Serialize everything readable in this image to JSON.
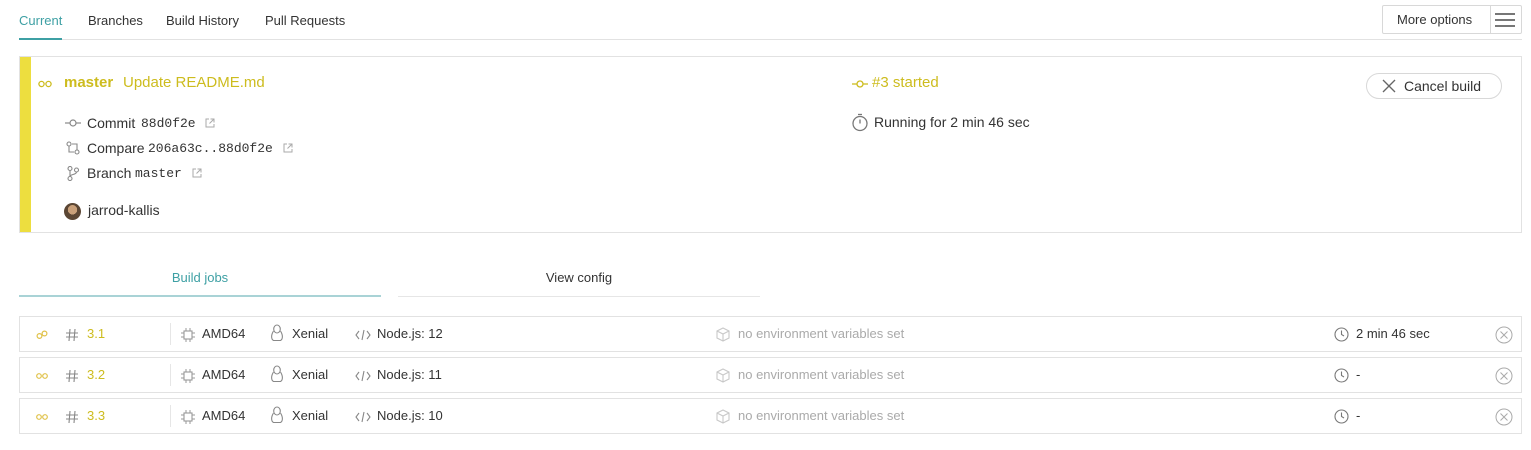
{
  "top_tabs": [
    {
      "label": "Current"
    },
    {
      "label": "Branches"
    },
    {
      "label": "Build History"
    },
    {
      "label": "Pull Requests"
    }
  ],
  "more_options": "More options",
  "build": {
    "branch": "master",
    "message": "Update README.md",
    "status": "#3 started",
    "running": "Running for 2 min 46 sec",
    "cancel_label": "Cancel build",
    "commit_label": "Commit",
    "commit_hash": "88d0f2e",
    "compare_label": "Compare",
    "compare_range": "206a63c..88d0f2e",
    "branch_label": "Branch",
    "branch_value": "master",
    "author": "jarrod-kallis",
    "accent_color": "#edde3f"
  },
  "sub_tabs": [
    {
      "label": "Build jobs"
    },
    {
      "label": "View config"
    }
  ],
  "jobs": [
    {
      "number": "3.1",
      "arch": "AMD64",
      "os": "Xenial",
      "lang": "Node.js: 12",
      "env": "no environment variables set",
      "duration": "2 min 46 sec"
    },
    {
      "number": "3.2",
      "arch": "AMD64",
      "os": "Xenial",
      "lang": "Node.js: 11",
      "env": "no environment variables set",
      "duration": "-"
    },
    {
      "number": "3.3",
      "arch": "AMD64",
      "os": "Xenial",
      "lang": "Node.js: 10",
      "env": "no environment variables set",
      "duration": "-"
    }
  ]
}
